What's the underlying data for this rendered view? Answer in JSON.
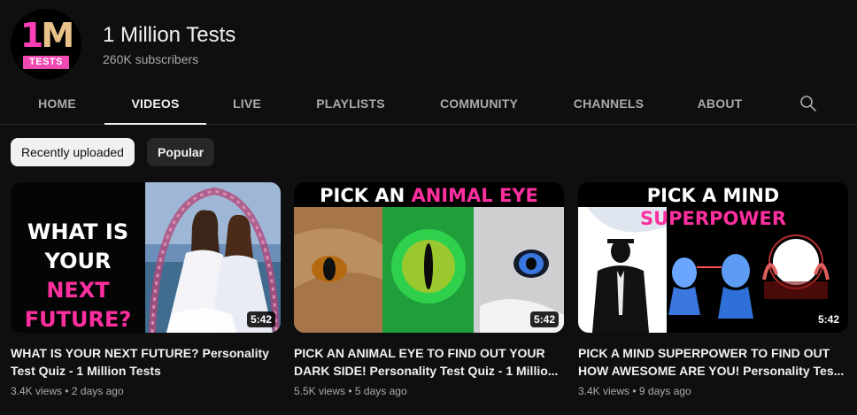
{
  "channel": {
    "name": "1 Million Tests",
    "subscribers": "260K subscribers",
    "avatar": {
      "mark_one": "1",
      "mark_m": "M",
      "tag": "TESTS"
    }
  },
  "tabs": [
    {
      "label": "HOME",
      "active": false
    },
    {
      "label": "VIDEOS",
      "active": true
    },
    {
      "label": "LIVE",
      "active": false
    },
    {
      "label": "PLAYLISTS",
      "active": false
    },
    {
      "label": "COMMUNITY",
      "active": false
    },
    {
      "label": "CHANNELS",
      "active": false
    },
    {
      "label": "ABOUT",
      "active": false
    }
  ],
  "search_icon": "search-icon",
  "chips": [
    {
      "label": "Recently uploaded",
      "selected": true
    },
    {
      "label": "Popular",
      "selected": false
    }
  ],
  "videos": [
    {
      "title": "WHAT IS YOUR NEXT FUTURE? Personality Test Quiz - 1 Million Tests",
      "views": "3.4K views",
      "age": "2 days ago",
      "duration": "5:42",
      "thumb": {
        "line1": "WHAT IS",
        "line2a": "YOUR ",
        "line2b": "NEXT",
        "line3": "FUTURE?"
      }
    },
    {
      "title": "PICK AN ANIMAL EYE TO FIND OUT YOUR DARK SIDE! Personality Test Quiz - 1 Millio...",
      "views": "5.5K views",
      "age": "5 days ago",
      "duration": "5:42",
      "thumb": {
        "a": "PICK AN ",
        "b": "ANIMAL EYE"
      }
    },
    {
      "title": "PICK A MIND SUPERPOWER TO FIND OUT HOW AWESOME ARE YOU! Personality Tes...",
      "views": "3.4K views",
      "age": "9 days ago",
      "duration": "5:42",
      "thumb": {
        "a": "PICK A MIND ",
        "b": "SUPERPOWER"
      }
    }
  ],
  "colors": {
    "background": "#0f0f0f",
    "accent_pink": "#ff2fa0",
    "text_secondary": "#aaaaaa"
  }
}
